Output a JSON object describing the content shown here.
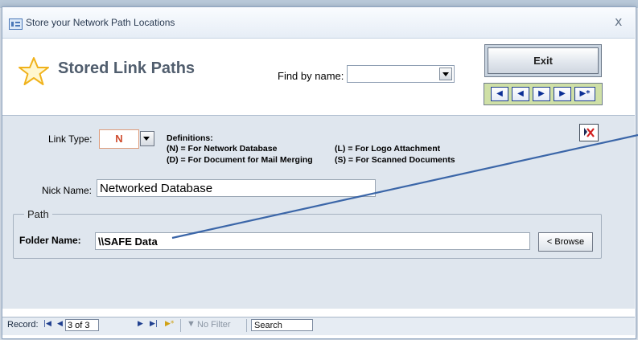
{
  "window": {
    "title": "Store your Network Path Locations",
    "close_glyph": "x"
  },
  "header": {
    "title": "Stored Link Paths",
    "find_label": "Find by name:",
    "find_value": "",
    "exit_label": "Exit",
    "nav_buttons": [
      "first",
      "previous",
      "next",
      "last",
      "new"
    ]
  },
  "form": {
    "link_type_label": "Link Type:",
    "link_type_value": "N",
    "definitions_title": "Definitions:",
    "definitions": [
      "(N) = For Network Database",
      "(L) = For Logo Attachment",
      "(D) = For Document for Mail Merging",
      "(S) = For Scanned Documents"
    ],
    "nick_name_label": "Nick Name:",
    "nick_name_value": "Networked Database",
    "path_legend": "Path",
    "folder_name_label": "Folder Name:",
    "folder_name_value": "\\\\SAFE Data",
    "browse_label": "< Browse"
  },
  "record_bar": {
    "label": "Record:",
    "current": "3 of 3",
    "filter_label": "No Filter",
    "search_label": "Search"
  },
  "colors": {
    "accent_red": "#cf4b2d",
    "nav_green": "#cfe0a6",
    "arrow": "#3b66a8"
  }
}
